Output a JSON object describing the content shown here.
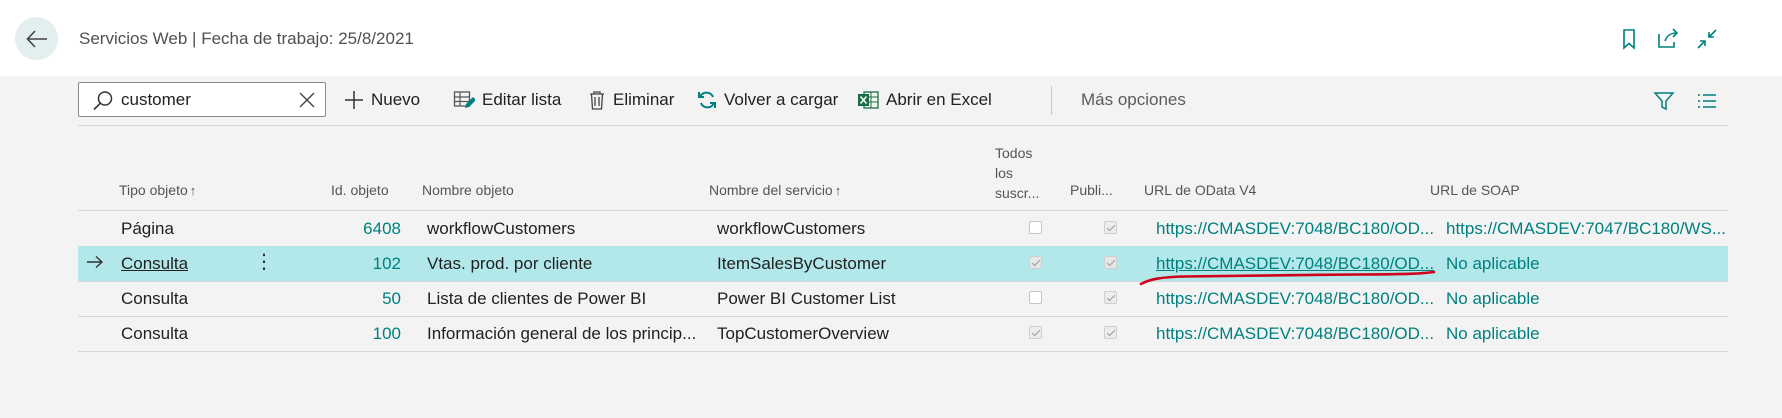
{
  "header": {
    "title": "Servicios Web | Fecha de trabajo: 25/8/2021",
    "icons": [
      "back-arrow-icon",
      "bookmark-icon",
      "open-new-window-icon",
      "collapse-icon"
    ]
  },
  "actions": {
    "search_value": "customer",
    "new": "Nuevo",
    "edit_list": "Editar lista",
    "delete": "Eliminar",
    "reload": "Volver a cargar",
    "open_excel": "Abrir en Excel",
    "more": "Más opciones"
  },
  "columns": {
    "object_type": "Tipo objeto",
    "object_id": "Id. objeto",
    "object_name": "Nombre objeto",
    "service_name": "Nombre del servicio",
    "all_tenants_1": "Todos",
    "all_tenants_2": "los",
    "all_tenants_3": "suscr...",
    "published": "Publi...",
    "odata_url": "URL de OData V4",
    "soap_url": "URL de SOAP"
  },
  "rows": [
    {
      "type": "Página",
      "id": "6408",
      "name": "workflowCustomers",
      "service": "workflowCustomers",
      "all_tenants": false,
      "published": true,
      "odata": "https://CMASDEV:7048/BC180/OD...",
      "soap": "https://CMASDEV:7047/BC180/WS..."
    },
    {
      "type": "Consulta",
      "id": "102",
      "name": "Vtas. prod. por cliente",
      "service": "ItemSalesByCustomer",
      "all_tenants": true,
      "published": true,
      "odata": "https://CMASDEV:7048/BC180/OD...",
      "soap": "No aplicable"
    },
    {
      "type": "Consulta",
      "id": "50",
      "name": "Lista de clientes de Power BI",
      "service": "Power BI Customer List",
      "all_tenants": false,
      "published": true,
      "odata": "https://CMASDEV:7048/BC180/OD...",
      "soap": "No aplicable"
    },
    {
      "type": "Consulta",
      "id": "100",
      "name": "Información general de los princip...",
      "service": "TopCustomerOverview",
      "all_tenants": true,
      "published": true,
      "odata": "https://CMASDEV:7048/BC180/OD...",
      "soap": "No aplicable"
    }
  ],
  "selected_row_index": 1,
  "colors": {
    "accent": "#00807f",
    "selected_row": "#b3e8eb",
    "annotation": "#d0021b"
  }
}
